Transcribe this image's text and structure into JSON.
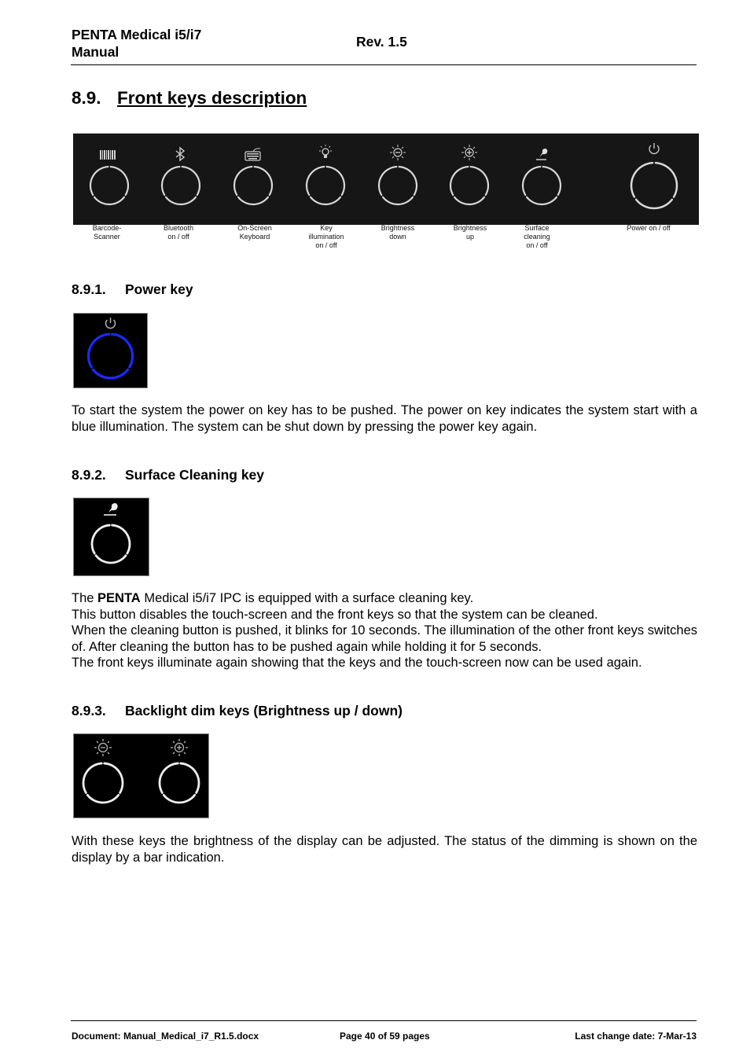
{
  "header": {
    "title_line1": "PENTA Medical i5/i7",
    "title_line2": "Manual",
    "revision": "Rev. 1.5"
  },
  "section": {
    "number": "8.9.",
    "title": "Front keys description"
  },
  "front_panel": {
    "keys": [
      {
        "icon": "barcode-icon",
        "label_lines": [
          "Barcode-",
          "Scanner"
        ]
      },
      {
        "icon": "bluetooth-icon",
        "label_lines": [
          "Bluetooth",
          "on / off"
        ]
      },
      {
        "icon": "keyboard-icon",
        "label_lines": [
          "On-Screen",
          "Keyboard"
        ]
      },
      {
        "icon": "lightbulb-icon",
        "label_lines": [
          "Key",
          "illumination",
          "on / off"
        ]
      },
      {
        "icon": "brightness-down-icon",
        "label_lines": [
          "Brightness",
          "down"
        ]
      },
      {
        "icon": "brightness-up-icon",
        "label_lines": [
          "Brightness",
          "up"
        ]
      },
      {
        "icon": "surface-cleaning-icon",
        "label_lines": [
          "Surface",
          "cleaning",
          "on / off"
        ]
      },
      {
        "icon": "power-icon",
        "label_lines": [
          "Power on / off"
        ]
      }
    ],
    "ring_color": "#d8d8d8",
    "panel_color": "#161616"
  },
  "subsections": [
    {
      "number": "8.9.1.",
      "title": "Power key",
      "ring_color": "#1a2cff",
      "paragraph": "To start the system the power on key has to be pushed. The power on key indicates the system start with a blue illumination. The system can be shut down by pressing the power key again."
    },
    {
      "number": "8.9.2.",
      "title": "Surface Cleaning key",
      "lines": [
        {
          "pre": "The ",
          "bold": "PENTA",
          "post": " Medical i5/i7 IPC is equipped with a surface cleaning key."
        },
        {
          "text": "This button disables the touch-screen and the front keys so that the system can be cleaned."
        },
        {
          "text": "When the cleaning button is pushed, it blinks for 10 seconds. The illumination of the other front keys switches of. After cleaning the button has to be pushed again while holding it for 5 seconds."
        },
        {
          "text": "The front keys illuminate again showing that the keys and the touch-screen now can be used again."
        }
      ]
    },
    {
      "number": "8.9.3.",
      "title": "Backlight dim keys (Brightness up / down)",
      "paragraph": "With these keys the brightness of the display can be adjusted. The status of the dimming is shown on the display by a bar indication."
    }
  ],
  "footer": {
    "document": "Document: Manual_Medical_i7_R1.5.docx",
    "page": "Page 40 of 59 pages",
    "date": "Last change date: 7-Mar-13"
  }
}
